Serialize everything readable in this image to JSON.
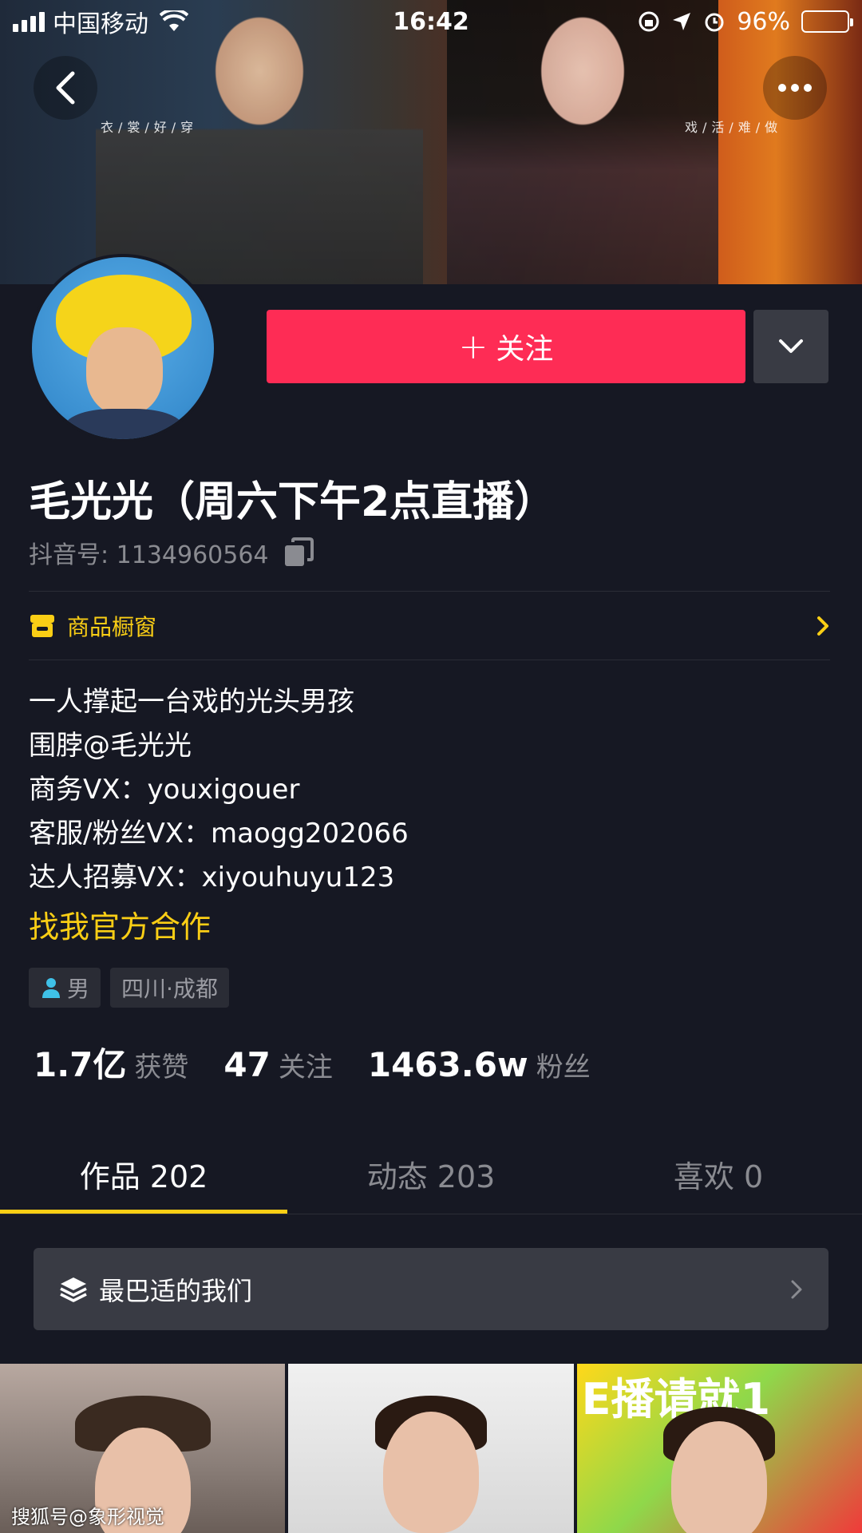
{
  "status_bar": {
    "carrier": "中国移动",
    "time": "16:42",
    "battery": "96%",
    "battery_level": 0.96
  },
  "cover": {
    "caption_left": "衣/裳/好/穿",
    "caption_right": "戏/活/难/做"
  },
  "header": {
    "follow_label": "关注",
    "follow_prefix": "+"
  },
  "profile": {
    "nickname": "毛光光（周六下午2点直播）",
    "douyin_id": "抖音号: 1134960564",
    "shop_label": "商品橱窗",
    "bio_lines": [
      "一人撑起一台戏的光头男孩",
      "围脖@毛光光",
      "商务VX：youxigouer",
      "客服/粉丝VX：maogg202066",
      "达人招募VX：xiyouhuyu123"
    ],
    "cooperate_link": "找我官方合作",
    "tags": [
      {
        "label": "男",
        "icon": "person-icon"
      },
      {
        "label": "四川·成都"
      }
    ],
    "stats": [
      {
        "value": "1.7亿",
        "label": "获赞"
      },
      {
        "value": "47",
        "label": "关注"
      },
      {
        "value": "1463.6w",
        "label": "粉丝"
      }
    ]
  },
  "tabs": [
    {
      "label": "作品 202",
      "active": true
    },
    {
      "label": "动态 203",
      "active": false
    },
    {
      "label": "喜欢 0",
      "active": false
    }
  ],
  "playlist": {
    "label": "最巴适的我们"
  },
  "thumbnails": [
    {
      "banner": ""
    },
    {
      "banner": ""
    },
    {
      "banner": "E播请就1"
    }
  ],
  "watermark": "搜狐号@象形视觉",
  "colors": {
    "background": "#161823",
    "accent_red": "#fe2c55",
    "accent_yellow": "#face15",
    "muted_text": "#8a8b91"
  }
}
